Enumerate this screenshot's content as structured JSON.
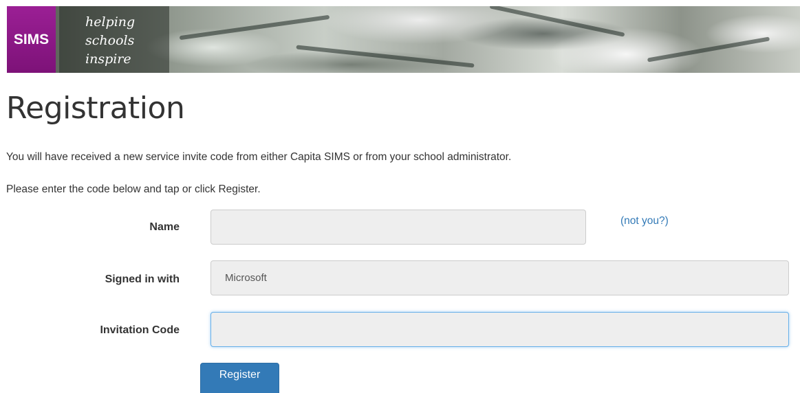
{
  "banner": {
    "brand": "SIMS",
    "tagline": [
      "helping",
      "schools",
      "inspire"
    ]
  },
  "page": {
    "title": "Registration",
    "intro_1": "You will have received a new service invite code from either Capita SIMS or from your school administrator.",
    "intro_2": "Please enter the code below and tap or click Register."
  },
  "form": {
    "name_label": "Name",
    "name_value": "",
    "not_you_link": "(not you?)",
    "signed_in_label": "Signed in with",
    "signed_in_value": "Microsoft",
    "invitation_label": "Invitation Code",
    "invitation_value": "",
    "register_button": "Register"
  },
  "colors": {
    "brand_purple": "#8a1886",
    "primary_button": "#337ab7",
    "link": "#337ab7"
  }
}
